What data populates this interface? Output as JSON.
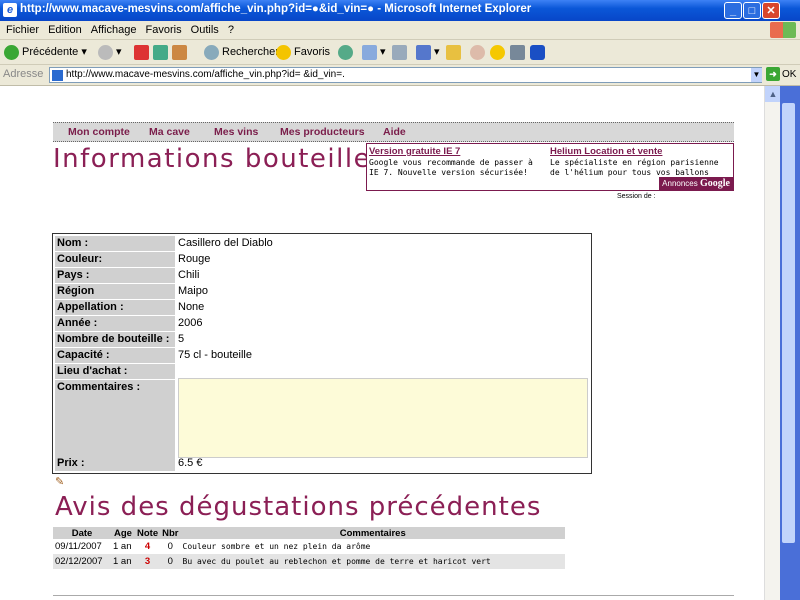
{
  "window": {
    "title": "http://www.macave-mesvins.com/affiche_vin.php?id=●&id_vin=● - Microsoft Internet Explorer"
  },
  "menubar": [
    "Fichier",
    "Edition",
    "Affichage",
    "Favoris",
    "Outils",
    "?"
  ],
  "toolbar": {
    "back": "Précédente",
    "search": "Rechercher",
    "favorites": "Favoris"
  },
  "address": {
    "label": "Adresse",
    "url": "http://www.macave-mesvins.com/affiche_vin.php?id=  &id_vin=.",
    "go": "OK"
  },
  "nav": [
    "Mon compte",
    "Ma cave",
    "Mes vins",
    "Mes producteurs",
    "Aide"
  ],
  "page_title": "Informations bouteille",
  "ads": [
    {
      "title": "Version gratuite IE 7",
      "text": "Google vous recommande de passer à IE 7. Nouvelle version sécurisée!"
    },
    {
      "title": "Helium Location et vente",
      "text": "Le spécialiste en région parisienne de l'hélium pour tous vos ballons"
    }
  ],
  "ads_badge": {
    "prefix": "Annonces",
    "brand": "Google"
  },
  "session": "Session de :",
  "wine": {
    "nom_label": "Nom :",
    "nom": "Casillero del Diablo",
    "couleur_label": "Couleur:",
    "couleur": "Rouge",
    "pays_label": "Pays :",
    "pays": "Chili",
    "region_label": "Région",
    "region": "Maipo",
    "appellation_label": "Appellation :",
    "appellation": "None",
    "annee_label": "Année :",
    "annee": "2006",
    "nombre_label": "Nombre de bouteille :",
    "nombre": "5",
    "capacite_label": "Capacité :",
    "capacite": "75 cl - bouteille",
    "lieu_label": "Lieu d'achat :",
    "lieu": "",
    "commentaires_label": "Commentaires :",
    "commentaires": "",
    "prix_label": "Prix :",
    "prix": "6.5 €"
  },
  "section_title": "Avis des dégustations précédentes",
  "tasting": {
    "headers": [
      "Date",
      "Age",
      "Note",
      "Nbr",
      "Commentaires"
    ],
    "rows": [
      {
        "date": "09/11/2007",
        "age": "1 an",
        "note": "4",
        "nbr": "0",
        "comment": "Couleur sombre et un nez plein da arôme"
      },
      {
        "date": "02/12/2007",
        "age": "1 an",
        "note": "3",
        "nbr": "0",
        "comment": "Bu avec du poulet au reblechon et pomme de terre et haricot vert"
      }
    ]
  }
}
